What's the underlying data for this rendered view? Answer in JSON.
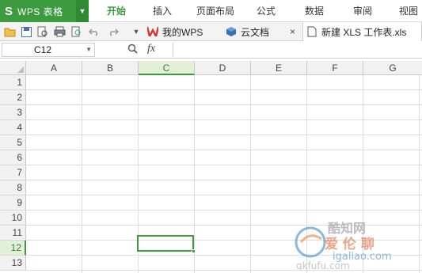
{
  "app": {
    "logo": "S",
    "title": "WPS 表格",
    "accent": "#3c9a3f"
  },
  "menu": [
    "开始",
    "插入",
    "页面布局",
    "公式",
    "数据",
    "审阅",
    "视图"
  ],
  "toolbar": {
    "icons": [
      "open-folder-icon",
      "save-icon",
      "print-preview-icon",
      "print-icon",
      "zoom-page-icon",
      "undo-icon",
      "redo-icon"
    ],
    "dropdown": "▼"
  },
  "tabs": {
    "mywps": "我的WPS",
    "cloud": "云文档",
    "close_glyph": "×",
    "document": "新建 XLS 工作表.xls"
  },
  "formula_bar": {
    "cell_ref": "C12",
    "fx": "fx",
    "value": ""
  },
  "grid": {
    "columns": [
      "A",
      "B",
      "C",
      "D",
      "E",
      "F",
      "G"
    ],
    "rows": [
      "1",
      "2",
      "3",
      "4",
      "5",
      "6",
      "7",
      "8",
      "9",
      "10",
      "11",
      "12",
      "13"
    ],
    "selected_column": "C",
    "selected_row": "12"
  },
  "watermark": {
    "line1": "酷知网",
    "line2": "爱 伦 聊",
    "line3": "igaliao.com",
    "line4": "qkfufu.com"
  }
}
